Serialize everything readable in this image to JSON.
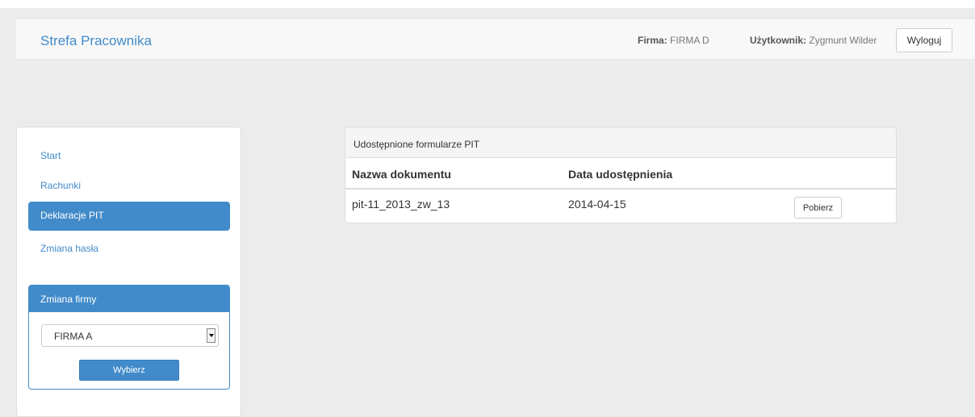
{
  "navbar": {
    "brand": "Strefa Pracownika",
    "company_label": "Firma:",
    "company_value": "FIRMA D",
    "user_label": "Użytkownik:",
    "user_value": "Zygmunt Wilder",
    "logout_label": "Wyloguj"
  },
  "sidebar": {
    "items": [
      {
        "label": "Start",
        "active": false
      },
      {
        "label": "Rachunki",
        "active": false
      },
      {
        "label": "Deklaracje PIT",
        "active": true
      },
      {
        "label": "Zmiana hasła",
        "active": false
      }
    ],
    "firm_panel": {
      "title": "Zmiana firmy",
      "selected_option": "FIRMA A",
      "submit_label": "Wybierz"
    }
  },
  "documents": {
    "panel_title": "Udostępnione formularze PIT",
    "columns": [
      "Nazwa dokumentu",
      "Data udostępnienia"
    ],
    "rows": [
      {
        "name": "pit-11_2013_zw_13",
        "date": "2014-04-15",
        "action_label": "Pobierz"
      }
    ]
  },
  "colors": {
    "accent": "#428bca",
    "background": "#ececec"
  }
}
